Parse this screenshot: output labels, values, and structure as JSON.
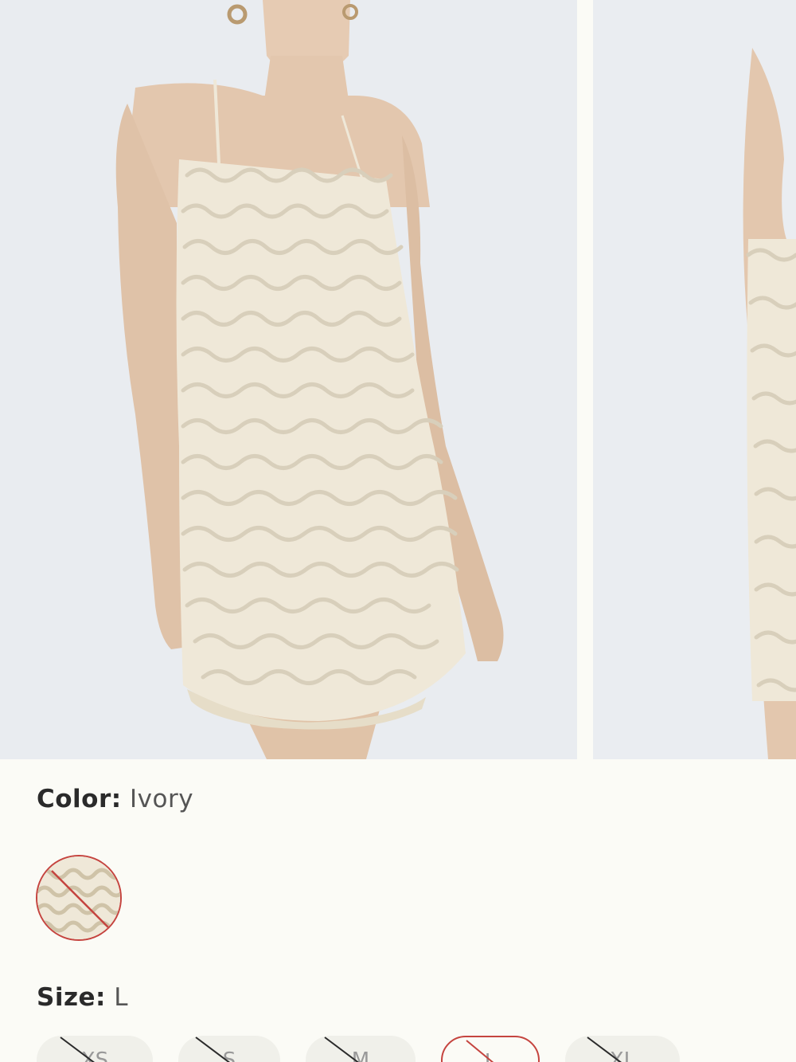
{
  "product": {
    "color_label": "Color:",
    "color_value": "Ivory",
    "size_label": "Size:",
    "size_value": "L",
    "color_options": [
      {
        "name": "Ivory",
        "selected": true,
        "available": false
      }
    ],
    "sizes": [
      {
        "label": "XS",
        "available": false,
        "selected": false
      },
      {
        "label": "S",
        "available": false,
        "selected": false
      },
      {
        "label": "M",
        "available": false,
        "selected": false
      },
      {
        "label": "L",
        "available": false,
        "selected": true
      },
      {
        "label": "XL",
        "available": false,
        "selected": false
      }
    ]
  },
  "colors": {
    "background": "#fbfbf6",
    "photo_backdrop": "#e9ecf0",
    "dress": "#efe8d8",
    "skin": "#e3c7ae",
    "unavailable_accent": "#c5443f"
  }
}
